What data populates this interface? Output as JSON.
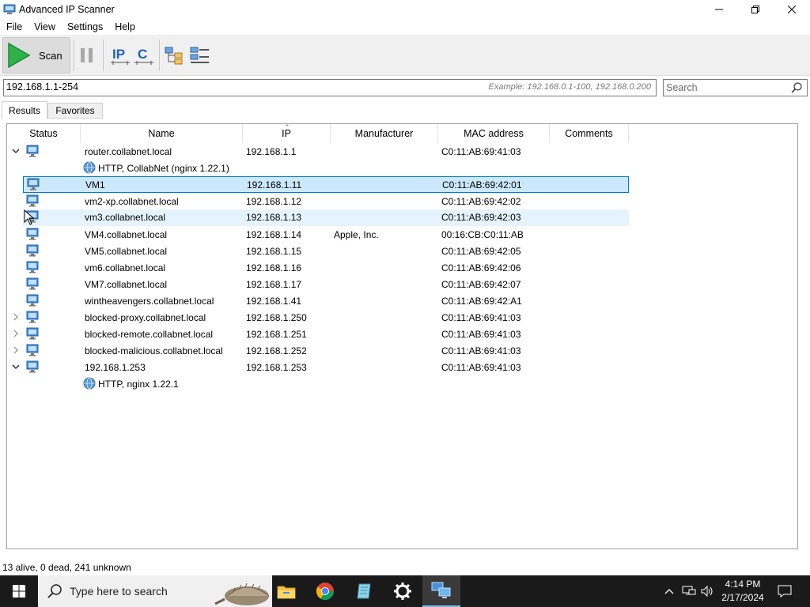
{
  "window": {
    "title": "Advanced IP Scanner",
    "icon": "scanner-app-icon"
  },
  "menu": [
    "File",
    "View",
    "Settings",
    "Help"
  ],
  "toolbar": {
    "scan_label": "Scan",
    "buttons": [
      "pause-icon",
      "ip-class-icon",
      "c-class-icon",
      "expand-all-icon",
      "collapse-all-icon"
    ]
  },
  "range": {
    "value": "192.168.1.1-254",
    "example": "Example: 192.168.0.1-100, 192.168.0.200"
  },
  "search": {
    "placeholder": "Search"
  },
  "tabs": [
    "Results",
    "Favorites"
  ],
  "columns": [
    "Status",
    "Name",
    "IP",
    "Manufacturer",
    "MAC address",
    "Comments"
  ],
  "rows": [
    {
      "name": "router.collabnet.local",
      "ip": "192.168.1.1",
      "manufacturer": "",
      "mac": "C0:11:AB:69:41:03",
      "expander": "expanded"
    },
    {
      "service": "HTTP, CollabNet (nginx 1.22.1)"
    },
    {
      "name": "VM1",
      "ip": "192.168.1.11",
      "manufacturer": "",
      "mac": "C0:11:AB:69:42:01",
      "state": "selected"
    },
    {
      "name": "vm2-xp.collabnet.local",
      "ip": "192.168.1.12",
      "manufacturer": "",
      "mac": "C0:11:AB:69:42:02"
    },
    {
      "name": "vm3.collabnet.local",
      "ip": "192.168.1.13",
      "manufacturer": "",
      "mac": "C0:11:AB:69:42:03",
      "state": "hover"
    },
    {
      "name": "VM4.collabnet.local",
      "ip": "192.168.1.14",
      "manufacturer": "Apple, Inc.",
      "mac": "00:16:CB:C0:11:AB"
    },
    {
      "name": "VM5.collabnet.local",
      "ip": "192.168.1.15",
      "manufacturer": "",
      "mac": "C0:11:AB:69:42:05"
    },
    {
      "name": "vm6.collabnet.local",
      "ip": "192.168.1.16",
      "manufacturer": "",
      "mac": "C0:11:AB:69:42:06"
    },
    {
      "name": "VM7.collabnet.local",
      "ip": "192.168.1.17",
      "manufacturer": "",
      "mac": "C0:11:AB:69:42:07"
    },
    {
      "name": "wintheavengers.collabnet.local",
      "ip": "192.168.1.41",
      "manufacturer": "",
      "mac": "C0:11:AB:69:42:A1"
    },
    {
      "name": "blocked-proxy.collabnet.local",
      "ip": "192.168.1.250",
      "manufacturer": "",
      "mac": "C0:11:AB:69:41:03",
      "expander": "collapsed"
    },
    {
      "name": "blocked-remote.collabnet.local",
      "ip": "192.168.1.251",
      "manufacturer": "",
      "mac": "C0:11:AB:69:41:03",
      "expander": "collapsed"
    },
    {
      "name": "blocked-malicious.collabnet.local",
      "ip": "192.168.1.252",
      "manufacturer": "",
      "mac": "C0:11:AB:69:41:03",
      "expander": "collapsed"
    },
    {
      "name": "192.168.1.253",
      "ip": "192.168.1.253",
      "manufacturer": "",
      "mac": "C0:11:AB:69:41:03",
      "expander": "expanded"
    },
    {
      "service": "HTTP, nginx 1.22.1"
    }
  ],
  "statusbar": {
    "text": "13 alive, 0 dead, 241 unknown"
  },
  "taskbar": {
    "search_placeholder": "Type here to search",
    "apps": [
      "file-explorer-icon",
      "chrome-icon",
      "notepad-icon",
      "settings-gear-icon",
      "ip-scanner-icon"
    ],
    "time": "4:14 PM",
    "date": "2/17/2024"
  },
  "colors": {
    "selection": "#cce8ff",
    "selection_border": "#0078d7",
    "hover": "#e5f3ff",
    "scan_green": "#2db34a",
    "taskbar": "#1a1a1a"
  }
}
